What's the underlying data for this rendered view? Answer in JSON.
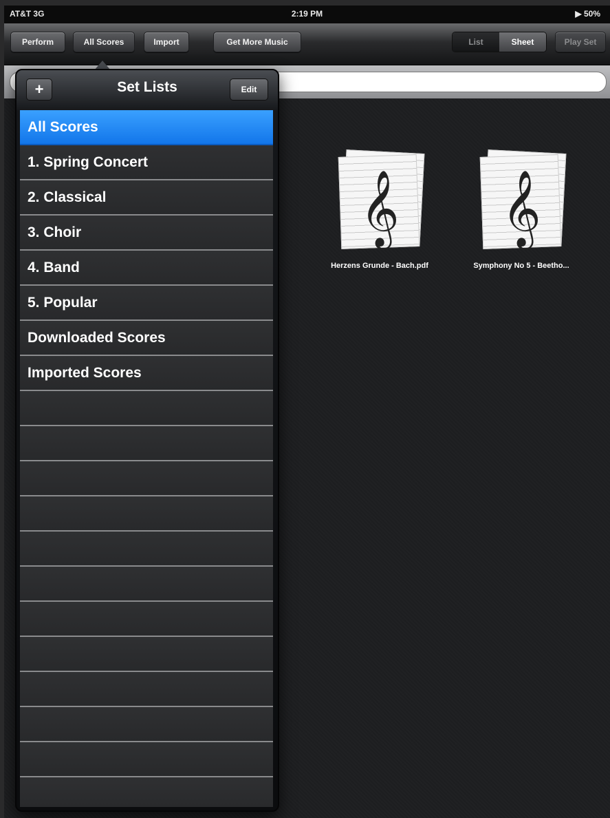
{
  "status_bar": {
    "carrier": "AT&T 3G",
    "time": "2:19 PM",
    "battery": "▶ 50%"
  },
  "toolbar": {
    "perform": "Perform",
    "all_scores": "All Scores",
    "import": "Import",
    "get_more_music": "Get More Music",
    "view_list": "List",
    "view_sheet": "Sheet",
    "play_set": "Play Set"
  },
  "search": {
    "placeholder": ""
  },
  "scores": [
    {
      "name": "Herzens Grunde - Bach.pdf"
    },
    {
      "name": "Symphony No 5 - Beetho..."
    }
  ],
  "popover": {
    "title": "Set Lists",
    "add_label": "+",
    "edit_label": "Edit",
    "items": [
      {
        "label": "All Scores",
        "selected": true
      },
      {
        "label": "1. Spring Concert",
        "selected": false
      },
      {
        "label": "2. Classical",
        "selected": false
      },
      {
        "label": "3. Choir",
        "selected": false
      },
      {
        "label": "4. Band",
        "selected": false
      },
      {
        "label": "5. Popular",
        "selected": false
      },
      {
        "label": "Downloaded Scores",
        "selected": false
      },
      {
        "label": "Imported Scores",
        "selected": false
      }
    ],
    "empty_rows": 12
  },
  "colors": {
    "selection": "#1a7cf0",
    "toolbar": "#2a2b2d"
  }
}
